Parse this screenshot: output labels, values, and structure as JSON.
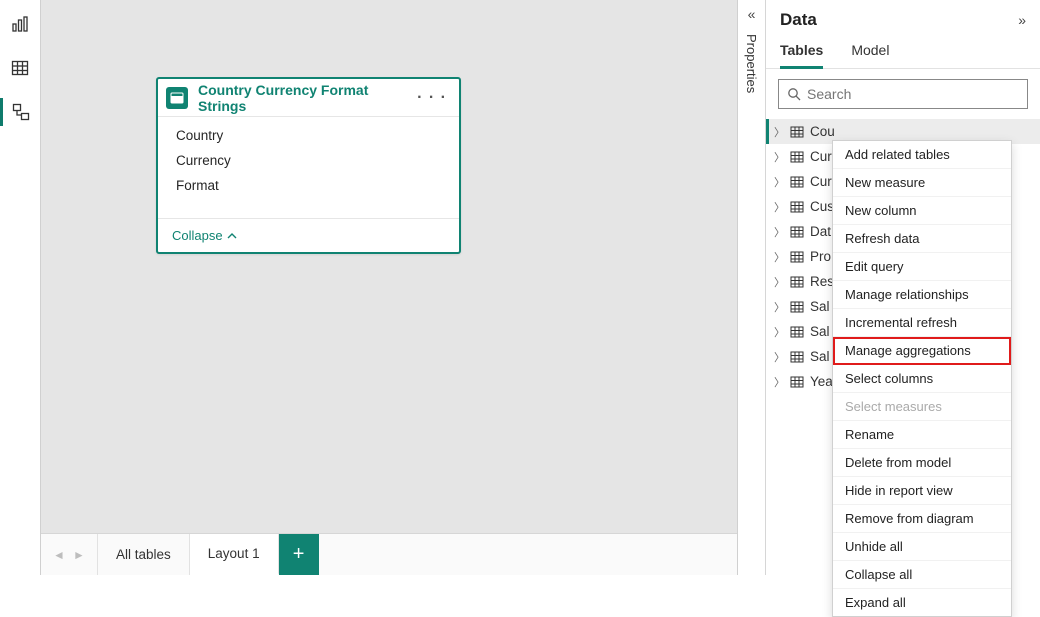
{
  "rail": {
    "icons": [
      "bar-chart-icon",
      "table-icon",
      "model-icon"
    ]
  },
  "card": {
    "title": "Country Currency Format Strings",
    "fields": [
      "Country",
      "Currency",
      "Format"
    ],
    "collapse_label": "Collapse"
  },
  "bottom": {
    "tab_all": "All tables",
    "tab_layout": "Layout 1"
  },
  "properties": {
    "label": "Properties"
  },
  "data_pane": {
    "title": "Data",
    "tab_tables": "Tables",
    "tab_model": "Model",
    "search_placeholder": "Search",
    "tables": [
      "Cou",
      "Cur",
      "Cur",
      "Cus",
      "Dat",
      "Pro",
      "Res",
      "Sal",
      "Sal",
      "Sal",
      "Yea"
    ]
  },
  "context_menu": {
    "items": [
      "Add related tables",
      "New measure",
      "New column",
      "Refresh data",
      "Edit query",
      "Manage relationships",
      "Incremental refresh",
      "Manage aggregations",
      "Select columns",
      "Select measures",
      "Rename",
      "Delete from model",
      "Hide in report view",
      "Remove from diagram",
      "Unhide all",
      "Collapse all",
      "Expand all"
    ],
    "disabled_index": 9,
    "highlight_index": 7
  }
}
